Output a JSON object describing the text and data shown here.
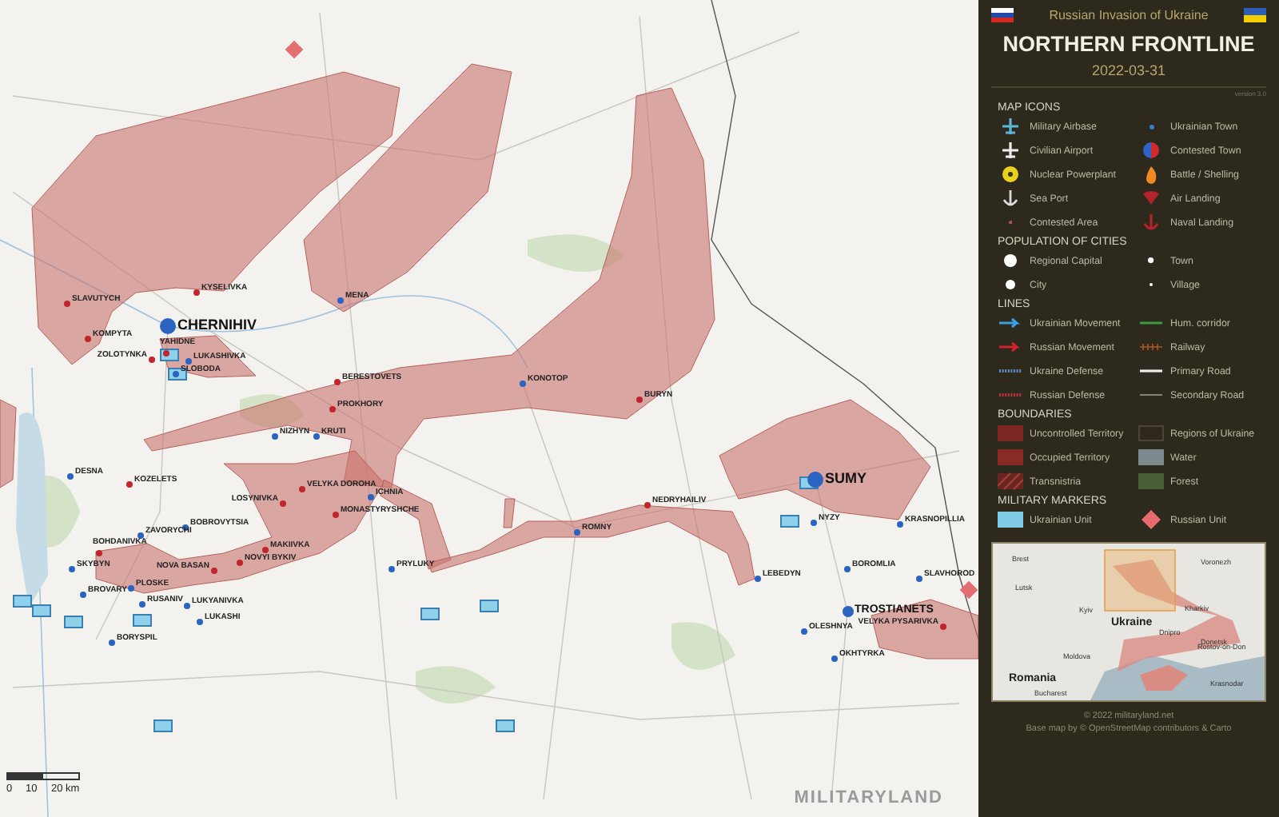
{
  "map": {
    "towns": [
      {
        "name": "SLAVUTYCH",
        "kind": "town",
        "color": "#c0262d"
      },
      {
        "name": "KYSELIVKA",
        "kind": "town",
        "color": "#c0262d"
      },
      {
        "name": "KOMPYTA",
        "kind": "town",
        "color": "#c0262d"
      },
      {
        "name": "CHERNIHIV",
        "kind": "capital",
        "color": "#2a63c0"
      },
      {
        "name": "ZOLOTYNKA",
        "kind": "town",
        "color": "#c0262d"
      },
      {
        "name": "YAHIDNE",
        "kind": "town",
        "color": "#c0262d"
      },
      {
        "name": "LUKASHIVKA",
        "kind": "town",
        "color": "#2a63c0"
      },
      {
        "name": "SLOBODA",
        "kind": "town",
        "color": "#2a63c0"
      },
      {
        "name": "MENA",
        "kind": "town",
        "color": "#2a63c0"
      },
      {
        "name": "BERESTOVETS",
        "kind": "town",
        "color": "#c0262d"
      },
      {
        "name": "PROKHORY",
        "kind": "town",
        "color": "#c0262d"
      },
      {
        "name": "NIZHYN",
        "kind": "town",
        "color": "#2a63c0"
      },
      {
        "name": "KRUTI",
        "kind": "town",
        "color": "#2a63c0"
      },
      {
        "name": "DESNA",
        "kind": "town",
        "color": "#2a63c0"
      },
      {
        "name": "KOZELETS",
        "kind": "town",
        "color": "#c0262d"
      },
      {
        "name": "BOBROVYTSIA",
        "kind": "town",
        "color": "#2a63c0"
      },
      {
        "name": "VELYKA DOROHA",
        "kind": "town",
        "color": "#c0262d"
      },
      {
        "name": "LOSYNIVKA",
        "kind": "town",
        "color": "#c0262d"
      },
      {
        "name": "ICHNIA",
        "kind": "town",
        "color": "#2a63c0"
      },
      {
        "name": "MONASTYRYSHCHE",
        "kind": "town",
        "color": "#c0262d"
      },
      {
        "name": "MAKIIVKA",
        "kind": "town",
        "color": "#c0262d"
      },
      {
        "name": "NOVYI BYKIV",
        "kind": "town",
        "color": "#c0262d"
      },
      {
        "name": "ZAVORYCHI",
        "kind": "town",
        "color": "#2a63c0"
      },
      {
        "name": "NOVA BASAN",
        "kind": "town",
        "color": "#c0262d"
      },
      {
        "name": "BOHDANIVKA",
        "kind": "town",
        "color": "#c0262d"
      },
      {
        "name": "SKYBYN",
        "kind": "town",
        "color": "#2a63c0"
      },
      {
        "name": "BROVARY",
        "kind": "town",
        "color": "#2a63c0"
      },
      {
        "name": "PLOSKE",
        "kind": "town",
        "color": "#2a63c0"
      },
      {
        "name": "RUSANIV",
        "kind": "town",
        "color": "#2a63c0"
      },
      {
        "name": "LUKYANIVKA",
        "kind": "town",
        "color": "#2a63c0"
      },
      {
        "name": "LUKASHI",
        "kind": "town",
        "color": "#2a63c0"
      },
      {
        "name": "BORYSPIL",
        "kind": "town",
        "color": "#2a63c0"
      },
      {
        "name": "PRYLUKY",
        "kind": "town",
        "color": "#2a63c0"
      },
      {
        "name": "KONOTOP",
        "kind": "town",
        "color": "#2a63c0"
      },
      {
        "name": "BURYN",
        "kind": "town",
        "color": "#c0262d"
      },
      {
        "name": "NEDRYHAILIV",
        "kind": "town",
        "color": "#c0262d"
      },
      {
        "name": "ROMNY",
        "kind": "town",
        "color": "#2a63c0"
      },
      {
        "name": "SUMY",
        "kind": "capital",
        "color": "#2a63c0"
      },
      {
        "name": "NYZY",
        "kind": "town",
        "color": "#2a63c0"
      },
      {
        "name": "KRASNOPILLIA",
        "kind": "town",
        "color": "#2a63c0"
      },
      {
        "name": "BOROMLIA",
        "kind": "town",
        "color": "#2a63c0"
      },
      {
        "name": "SLAVHOROD",
        "kind": "town",
        "color": "#2a63c0"
      },
      {
        "name": "TROSTIANETS",
        "kind": "city",
        "color": "#2a63c0"
      },
      {
        "name": "LEBEDYN",
        "kind": "town",
        "color": "#2a63c0"
      },
      {
        "name": "VELYKA PYSARIVKA",
        "kind": "town",
        "color": "#c0262d"
      },
      {
        "name": "OLESHNYA",
        "kind": "town",
        "color": "#2a63c0"
      },
      {
        "name": "OKHTYRKA",
        "kind": "town",
        "color": "#2a63c0"
      }
    ],
    "scale": [
      "0",
      "10",
      "20 km"
    ],
    "logo": "MILITARYLAND"
  },
  "legend": {
    "subtitle": "Russian Invasion of Ukraine",
    "title": "NORTHERN FRONTLINE",
    "date": "2022-03-31",
    "version": "version 3.0",
    "sections": [
      {
        "heading": "MAP ICONS",
        "items": [
          {
            "label": "Military Airbase",
            "kind": "airbase"
          },
          {
            "label": "Ukrainian Town",
            "kind": "ukrtown"
          },
          {
            "label": "Civilian Airport",
            "kind": "airport"
          },
          {
            "label": "Contested Town",
            "kind": "contested"
          },
          {
            "label": "Nuclear Powerplant",
            "kind": "nuclear"
          },
          {
            "label": "Battle / Shelling",
            "kind": "battle"
          },
          {
            "label": "Sea Port",
            "kind": "port"
          },
          {
            "label": "Air Landing",
            "kind": "airlanding"
          },
          {
            "label": "Contested Area",
            "kind": "contestedarea"
          },
          {
            "label": "Naval Landing",
            "kind": "navallanding"
          }
        ]
      },
      {
        "heading": "POPULATION OF CITIES",
        "items": [
          {
            "label": "Regional Capital",
            "kind": "capital"
          },
          {
            "label": "Town",
            "kind": "town"
          },
          {
            "label": "City",
            "kind": "city"
          },
          {
            "label": "Village",
            "kind": "village"
          }
        ]
      },
      {
        "heading": "LINES",
        "items": [
          {
            "label": "Ukrainian Movement",
            "kind": "ukrmove"
          },
          {
            "label": "Hum. corridor",
            "kind": "corridor"
          },
          {
            "label": "Russian Movement",
            "kind": "rusmove"
          },
          {
            "label": "Railway",
            "kind": "railway"
          },
          {
            "label": "Ukraine Defense",
            "kind": "ukrdef"
          },
          {
            "label": "Primary Road",
            "kind": "primary"
          },
          {
            "label": "Russian Defense",
            "kind": "rusdef"
          },
          {
            "label": "Secondary Road",
            "kind": "secondary"
          }
        ]
      },
      {
        "heading": "BOUNDARIES",
        "items": [
          {
            "label": "Uncontrolled Territory",
            "kind": "uncontrolled"
          },
          {
            "label": "Regions of Ukraine",
            "kind": "regions"
          },
          {
            "label": "Occupied Territory",
            "kind": "occupied"
          },
          {
            "label": "Water",
            "kind": "water"
          },
          {
            "label": "Transnistria",
            "kind": "transnistria"
          },
          {
            "label": "Forest",
            "kind": "forest"
          }
        ]
      },
      {
        "heading": "MILITARY MARKERS",
        "items": [
          {
            "label": "Ukrainian Unit",
            "kind": "ukrunit"
          },
          {
            "label": "Russian Unit",
            "kind": "rusunit"
          }
        ]
      }
    ],
    "inset": {
      "labels": [
        {
          "text": "Brest",
          "kind": "city"
        },
        {
          "text": "Voronezh",
          "kind": "city"
        },
        {
          "text": "Lutsk",
          "kind": "city"
        },
        {
          "text": "Kyiv",
          "kind": "city"
        },
        {
          "text": "Kharkiv",
          "kind": "city"
        },
        {
          "text": "Ukraine",
          "kind": "country"
        },
        {
          "text": "Dnipro",
          "kind": "city"
        },
        {
          "text": "Donetsk",
          "kind": "city"
        },
        {
          "text": "Rostov-on-Don",
          "kind": "city"
        },
        {
          "text": "Moldova",
          "kind": "city"
        },
        {
          "text": "Romania",
          "kind": "country"
        },
        {
          "text": "Krasnodar",
          "kind": "city"
        },
        {
          "text": "Bucharest",
          "kind": "city"
        }
      ]
    },
    "footer": [
      "© 2022 militaryland.net",
      "Base map by © OpenStreetMap contributors & Carto"
    ]
  }
}
